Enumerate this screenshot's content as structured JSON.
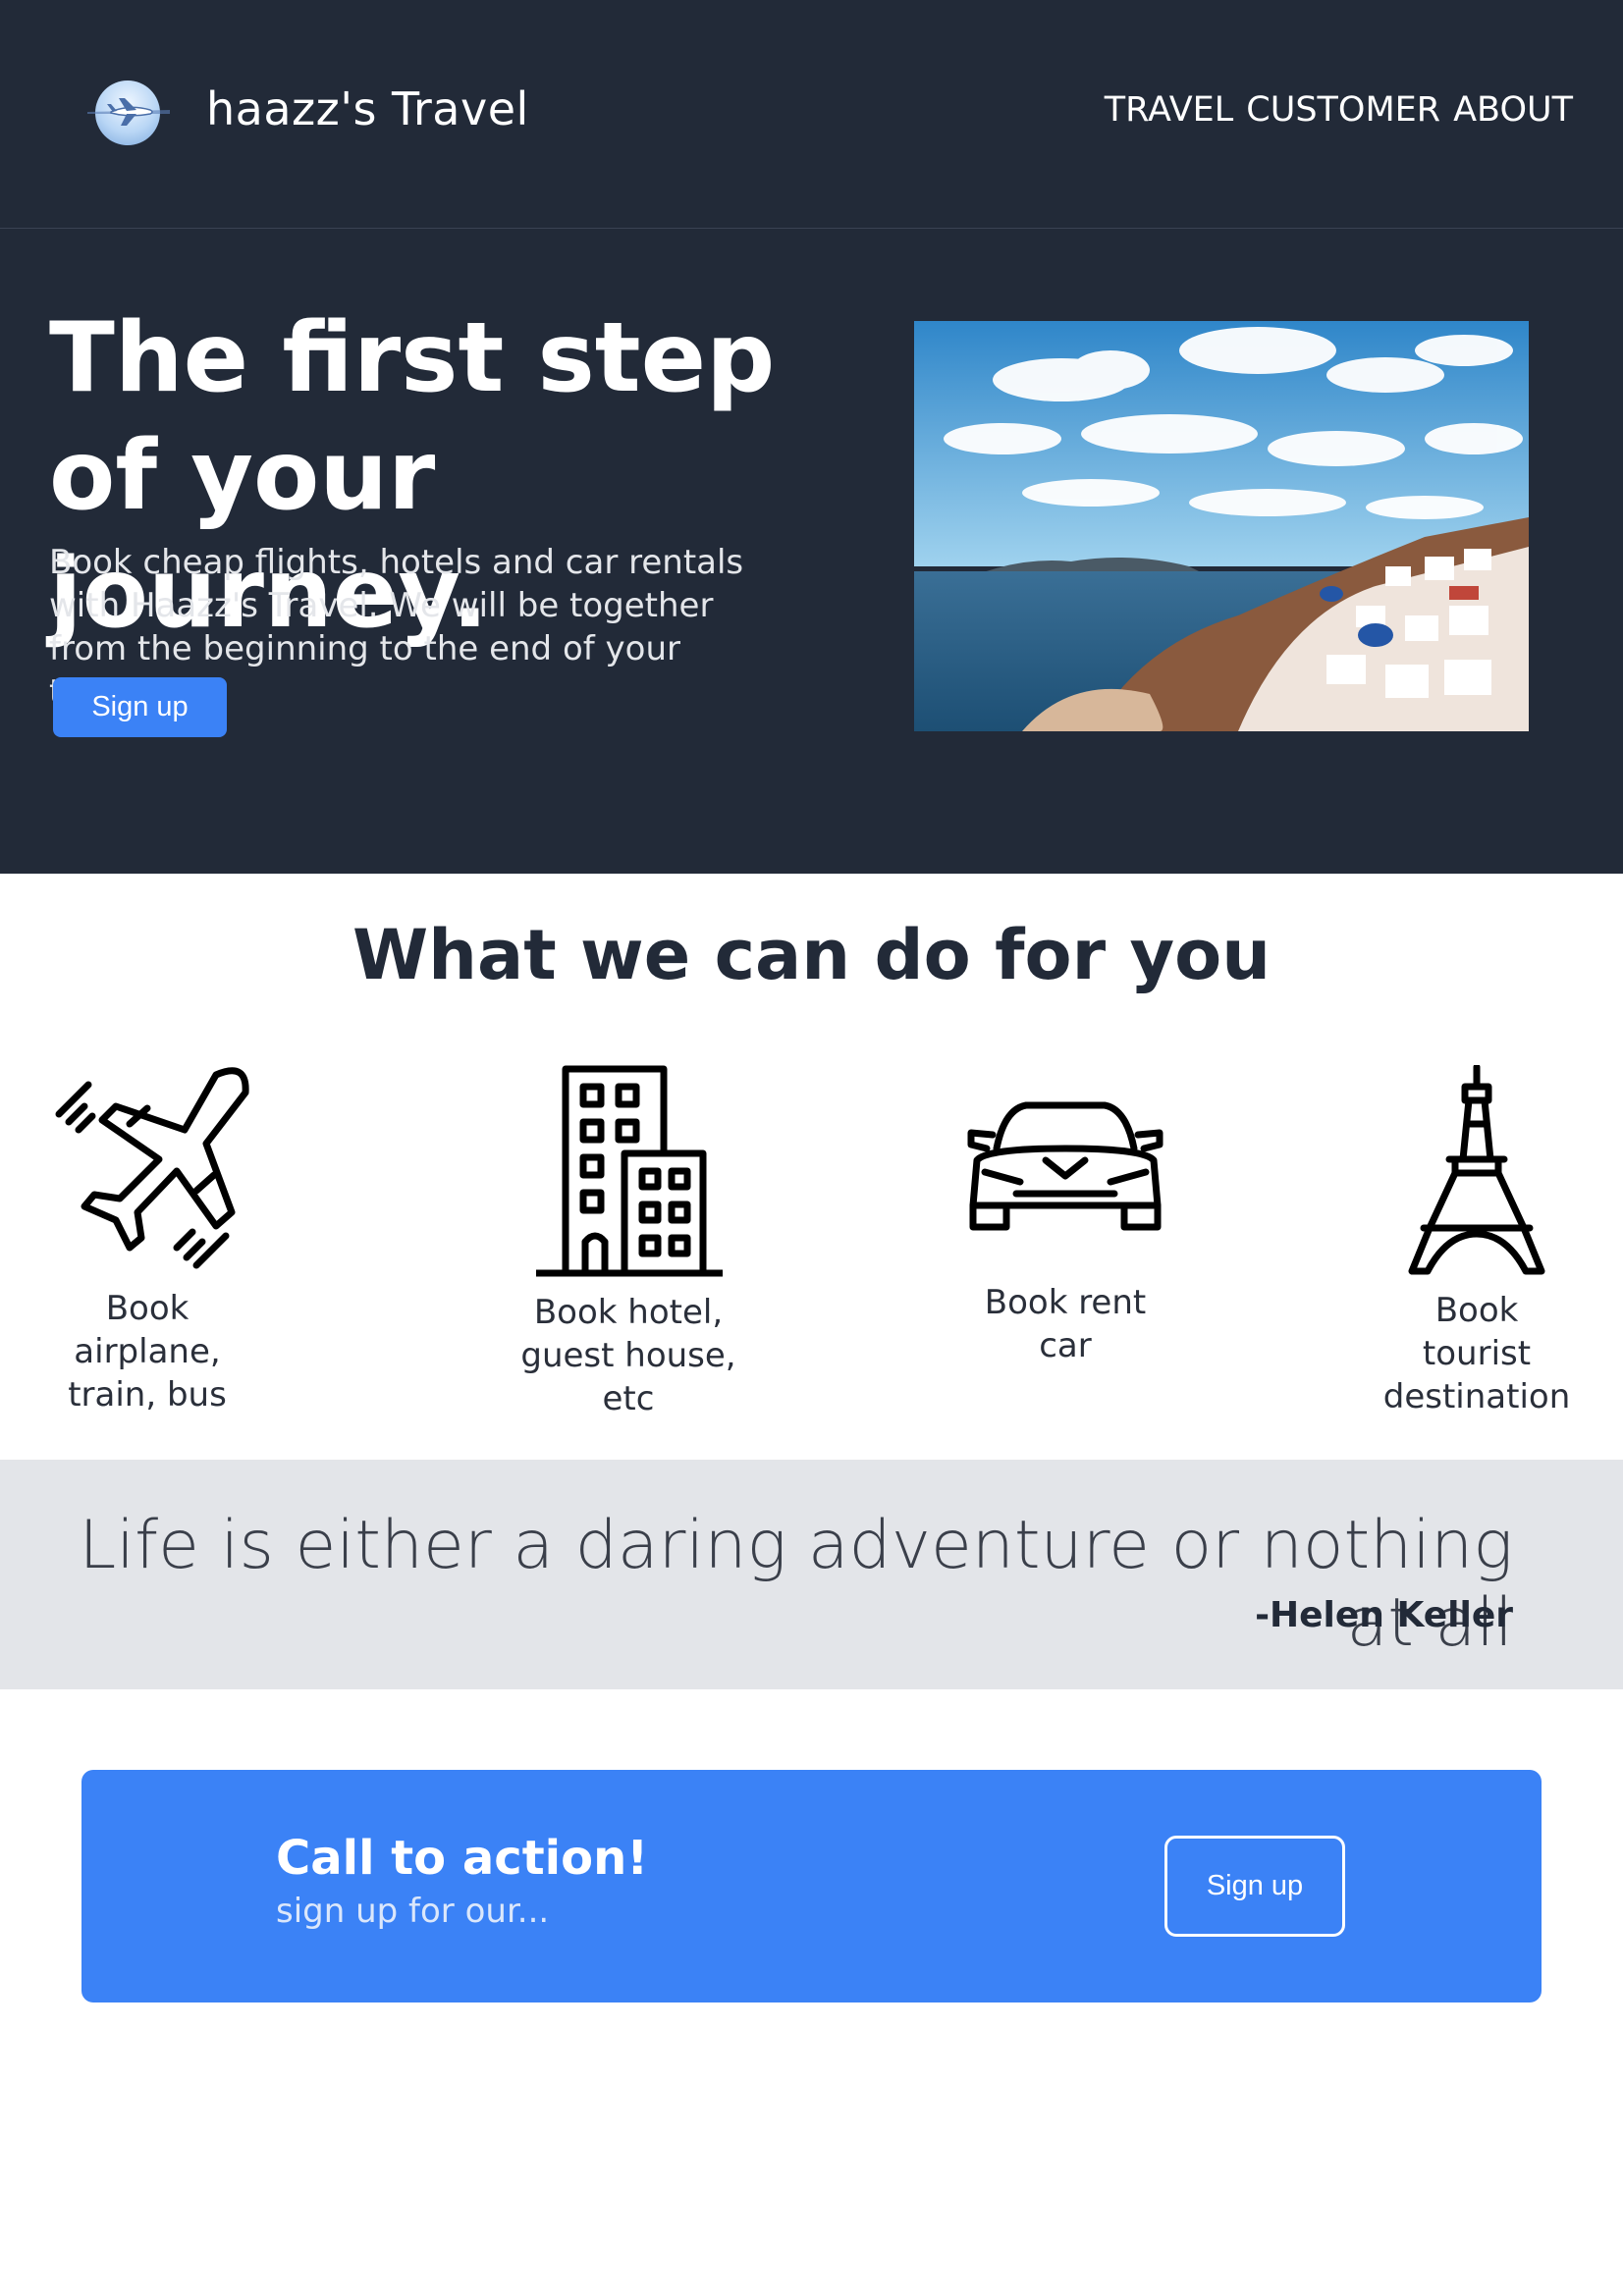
{
  "header": {
    "brand": "haazz's Travel",
    "nav": [
      "TRAVEL",
      "CUSTOMER",
      "ABOUT"
    ],
    "logo_icon": "airplane-globe-icon"
  },
  "hero": {
    "title": "The first step of your journey.",
    "description": "Book cheap flights, hotels and car rentals with Haazz's Travel. We will be together from the beginning to the end of your travel.",
    "button_label": "Sign up",
    "image_icon": "santorini-coast-photo"
  },
  "services": {
    "title": "What we can do for you",
    "items": [
      {
        "label": "Book airplane, train, bus",
        "icon": "airplane-icon"
      },
      {
        "label": "Book hotel, guest house, etc",
        "icon": "building-icon"
      },
      {
        "label": "Book rent car",
        "icon": "car-icon"
      },
      {
        "label": "Book tourist destination",
        "icon": "eiffel-tower-icon"
      }
    ]
  },
  "quote": {
    "text": "Life is either a daring adventure or nothing at all",
    "author": "-Helen Keller"
  },
  "cta": {
    "title": "Call to action!",
    "subtitle": "sign up for our...",
    "button_label": "Sign up"
  },
  "colors": {
    "dark": "#222a38",
    "accent": "#3b82f6",
    "quote_band": "#e3e5e9"
  }
}
